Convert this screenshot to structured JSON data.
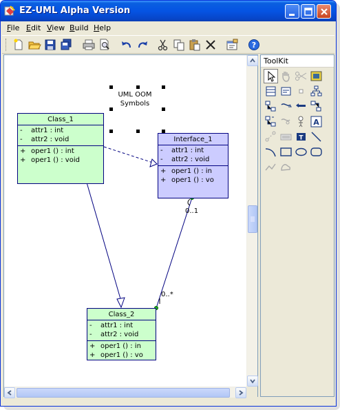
{
  "window": {
    "title": "EZ-UML Alpha Version"
  },
  "menu": {
    "items": [
      {
        "label": "File",
        "key": "F",
        "rest": "ile"
      },
      {
        "label": "Edit",
        "key": "E",
        "rest": "dit"
      },
      {
        "label": "View",
        "key": "V",
        "rest": "iew"
      },
      {
        "label": "Build",
        "key": "B",
        "rest": "uild"
      },
      {
        "label": "Help",
        "key": "H",
        "rest": "elp"
      }
    ]
  },
  "toolkit": {
    "title": "ToolKit"
  },
  "diagram": {
    "note": {
      "line1": "UML OOM",
      "line2": "Symbols"
    },
    "class1": {
      "name": "Class_1",
      "attributes": [
        {
          "vis": "-",
          "text": "attr1  : int"
        },
        {
          "vis": "-",
          "text": "attr2  : void"
        }
      ],
      "operations": [
        {
          "vis": "+",
          "text": "oper1 ()  : int"
        },
        {
          "vis": "+",
          "text": "oper1 ()  : void"
        }
      ]
    },
    "interface1": {
      "name": "Interface_1",
      "attributes": [
        {
          "vis": "-",
          "text": "attr1  : int"
        },
        {
          "vis": "-",
          "text": "attr2  : void"
        }
      ],
      "operations": [
        {
          "vis": "+",
          "text": "oper1 ()  : in"
        },
        {
          "vis": "+",
          "text": "oper1 ()  : vo"
        }
      ]
    },
    "class2": {
      "name": "Class_2",
      "attributes": [
        {
          "vis": "-",
          "text": "attr1  : int"
        },
        {
          "vis": "-",
          "text": "attr2  : void"
        }
      ],
      "operations": [
        {
          "vis": "+",
          "text": "oper1 ()  : in"
        },
        {
          "vis": "+",
          "text": "oper1 ()  : vo"
        }
      ]
    },
    "multiplicity_source": "0..1",
    "multiplicity_target": "0..*"
  },
  "colors": {
    "class_fill": "#ccffcc",
    "interface_fill": "#ccccff",
    "line": "#000080",
    "titlebar": "#0554e3"
  }
}
